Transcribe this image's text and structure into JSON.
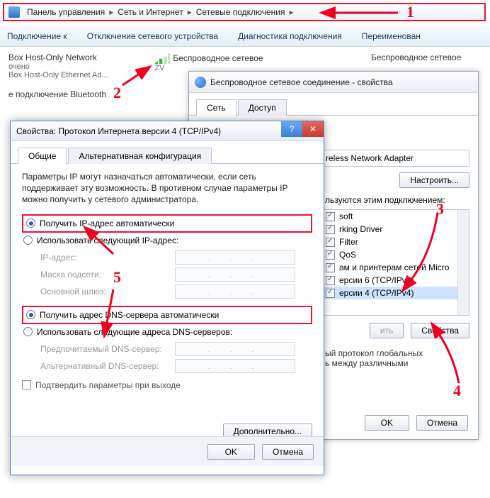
{
  "breadcrumb": {
    "items": [
      "Панель управления",
      "Сеть и Интернет",
      "Сетевые подключения"
    ]
  },
  "toolbar": {
    "items": [
      "Подключение к",
      "Отключение сетевого устройства",
      "Диагностика подключения",
      "Переименован"
    ]
  },
  "networks": {
    "n0": {
      "title": "Box Host-Only Network",
      "sub1": "очено",
      "sub2": "Box Host-Only Ethernet Ad..."
    },
    "n1": {
      "title": "Беспроводное сетевое",
      "sub1": "ZV"
    },
    "n2": {
      "title": "е подключение Bluetooth"
    },
    "n3": {
      "title": "Беспроводное сетевое"
    }
  },
  "wireless": {
    "title": "Беспроводное сетевое соединение - свойства",
    "tabs": {
      "t0": "Сеть",
      "t1": "Доступ"
    },
    "adapter_fragment": "reless Network Adapter",
    "configure": "Настроить...",
    "uses_label_fragment": "льзуются этим подключением:",
    "items": {
      "i0": "soft",
      "i1": "rking Driver",
      "i2": "Filter",
      "i3": "QoS",
      "i4": "ам и принтерам сетей Micro",
      "i5": "ерсии 6 (TCP/IPv6)",
      "i6": "ерсии 4 (TCP/IPv4)"
    },
    "btn_install": "ить",
    "btn_props": "Свойства",
    "desc": "ый протокол глобальных\nь между различными",
    "ok": "OK",
    "cancel": "Отмена"
  },
  "ipv4": {
    "title": "Свойства: Протокол Интернета версии 4 (TCP/IPv4)",
    "tabs": {
      "t0": "Общие",
      "t1": "Альтернативная конфигурация"
    },
    "intro": "Параметры IP могут назначаться автоматически, если сеть поддерживает эту возможность. В противном случае параметры IP можно получить у сетевого администратора.",
    "r_auto_ip": "Получить IP-адрес автоматически",
    "r_manual_ip": "Использовать следующий IP-адрес:",
    "f_ip": "IP-адрес:",
    "f_mask": "Маска подсети:",
    "f_gw": "Основной шлюз:",
    "r_auto_dns": "Получить адрес DNS-сервера автоматически",
    "r_manual_dns": "Использовать следующие адреса DNS-серверов:",
    "f_dns1": "Предпочитаемый DNS-сервер:",
    "f_dns2": "Альтернативный DNS-сервер:",
    "chk_validate": "Подтвердить параметры при выходе",
    "btn_adv": "Дополнительно...",
    "ok": "OK",
    "cancel": "Отмена",
    "dots": ".  .  ."
  },
  "annotations": {
    "a1": "1",
    "a2": "2",
    "a3": "3",
    "a4": "4",
    "a5": "5"
  }
}
